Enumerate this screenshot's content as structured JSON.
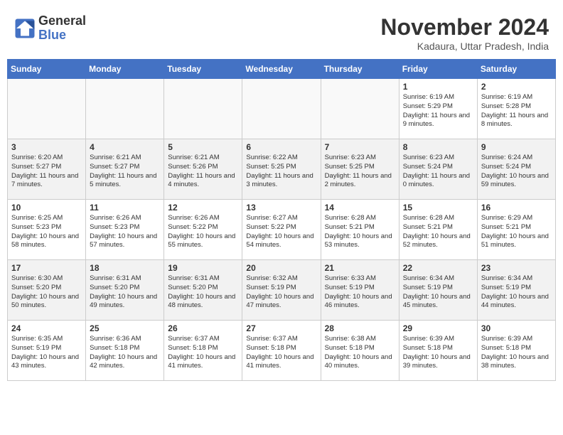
{
  "header": {
    "logo_line1": "General",
    "logo_line2": "Blue",
    "month_title": "November 2024",
    "location": "Kadaura, Uttar Pradesh, India"
  },
  "days_of_week": [
    "Sunday",
    "Monday",
    "Tuesday",
    "Wednesday",
    "Thursday",
    "Friday",
    "Saturday"
  ],
  "weeks": [
    [
      {
        "num": "",
        "detail": "",
        "empty": true
      },
      {
        "num": "",
        "detail": "",
        "empty": true
      },
      {
        "num": "",
        "detail": "",
        "empty": true
      },
      {
        "num": "",
        "detail": "",
        "empty": true
      },
      {
        "num": "",
        "detail": "",
        "empty": true
      },
      {
        "num": "1",
        "detail": "Sunrise: 6:19 AM\nSunset: 5:29 PM\nDaylight: 11 hours and 9 minutes."
      },
      {
        "num": "2",
        "detail": "Sunrise: 6:19 AM\nSunset: 5:28 PM\nDaylight: 11 hours and 8 minutes."
      }
    ],
    [
      {
        "num": "3",
        "detail": "Sunrise: 6:20 AM\nSunset: 5:27 PM\nDaylight: 11 hours and 7 minutes."
      },
      {
        "num": "4",
        "detail": "Sunrise: 6:21 AM\nSunset: 5:27 PM\nDaylight: 11 hours and 5 minutes."
      },
      {
        "num": "5",
        "detail": "Sunrise: 6:21 AM\nSunset: 5:26 PM\nDaylight: 11 hours and 4 minutes."
      },
      {
        "num": "6",
        "detail": "Sunrise: 6:22 AM\nSunset: 5:25 PM\nDaylight: 11 hours and 3 minutes."
      },
      {
        "num": "7",
        "detail": "Sunrise: 6:23 AM\nSunset: 5:25 PM\nDaylight: 11 hours and 2 minutes."
      },
      {
        "num": "8",
        "detail": "Sunrise: 6:23 AM\nSunset: 5:24 PM\nDaylight: 11 hours and 0 minutes."
      },
      {
        "num": "9",
        "detail": "Sunrise: 6:24 AM\nSunset: 5:24 PM\nDaylight: 10 hours and 59 minutes."
      }
    ],
    [
      {
        "num": "10",
        "detail": "Sunrise: 6:25 AM\nSunset: 5:23 PM\nDaylight: 10 hours and 58 minutes."
      },
      {
        "num": "11",
        "detail": "Sunrise: 6:26 AM\nSunset: 5:23 PM\nDaylight: 10 hours and 57 minutes."
      },
      {
        "num": "12",
        "detail": "Sunrise: 6:26 AM\nSunset: 5:22 PM\nDaylight: 10 hours and 55 minutes."
      },
      {
        "num": "13",
        "detail": "Sunrise: 6:27 AM\nSunset: 5:22 PM\nDaylight: 10 hours and 54 minutes."
      },
      {
        "num": "14",
        "detail": "Sunrise: 6:28 AM\nSunset: 5:21 PM\nDaylight: 10 hours and 53 minutes."
      },
      {
        "num": "15",
        "detail": "Sunrise: 6:28 AM\nSunset: 5:21 PM\nDaylight: 10 hours and 52 minutes."
      },
      {
        "num": "16",
        "detail": "Sunrise: 6:29 AM\nSunset: 5:21 PM\nDaylight: 10 hours and 51 minutes."
      }
    ],
    [
      {
        "num": "17",
        "detail": "Sunrise: 6:30 AM\nSunset: 5:20 PM\nDaylight: 10 hours and 50 minutes."
      },
      {
        "num": "18",
        "detail": "Sunrise: 6:31 AM\nSunset: 5:20 PM\nDaylight: 10 hours and 49 minutes."
      },
      {
        "num": "19",
        "detail": "Sunrise: 6:31 AM\nSunset: 5:20 PM\nDaylight: 10 hours and 48 minutes."
      },
      {
        "num": "20",
        "detail": "Sunrise: 6:32 AM\nSunset: 5:19 PM\nDaylight: 10 hours and 47 minutes."
      },
      {
        "num": "21",
        "detail": "Sunrise: 6:33 AM\nSunset: 5:19 PM\nDaylight: 10 hours and 46 minutes."
      },
      {
        "num": "22",
        "detail": "Sunrise: 6:34 AM\nSunset: 5:19 PM\nDaylight: 10 hours and 45 minutes."
      },
      {
        "num": "23",
        "detail": "Sunrise: 6:34 AM\nSunset: 5:19 PM\nDaylight: 10 hours and 44 minutes."
      }
    ],
    [
      {
        "num": "24",
        "detail": "Sunrise: 6:35 AM\nSunset: 5:19 PM\nDaylight: 10 hours and 43 minutes."
      },
      {
        "num": "25",
        "detail": "Sunrise: 6:36 AM\nSunset: 5:18 PM\nDaylight: 10 hours and 42 minutes."
      },
      {
        "num": "26",
        "detail": "Sunrise: 6:37 AM\nSunset: 5:18 PM\nDaylight: 10 hours and 41 minutes."
      },
      {
        "num": "27",
        "detail": "Sunrise: 6:37 AM\nSunset: 5:18 PM\nDaylight: 10 hours and 41 minutes."
      },
      {
        "num": "28",
        "detail": "Sunrise: 6:38 AM\nSunset: 5:18 PM\nDaylight: 10 hours and 40 minutes."
      },
      {
        "num": "29",
        "detail": "Sunrise: 6:39 AM\nSunset: 5:18 PM\nDaylight: 10 hours and 39 minutes."
      },
      {
        "num": "30",
        "detail": "Sunrise: 6:39 AM\nSunset: 5:18 PM\nDaylight: 10 hours and 38 minutes."
      }
    ]
  ]
}
